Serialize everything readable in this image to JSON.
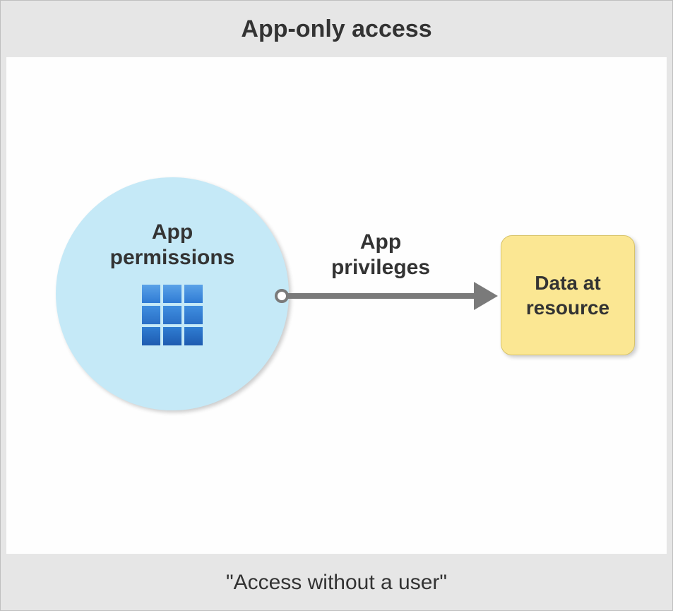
{
  "title": "App-only access",
  "footer": "\"Access without a user\"",
  "circle": {
    "label": "App\npermissions"
  },
  "arrow": {
    "label": "App\nprivileges"
  },
  "resource": {
    "label": "Data at\nresource"
  },
  "icons": {
    "grid": "app-grid-icon"
  },
  "colors": {
    "circle_fill": "#c5e9f7",
    "resource_fill": "#fbe793",
    "arrow": "#7a7a7a",
    "page_bg": "#e6e6e6"
  }
}
